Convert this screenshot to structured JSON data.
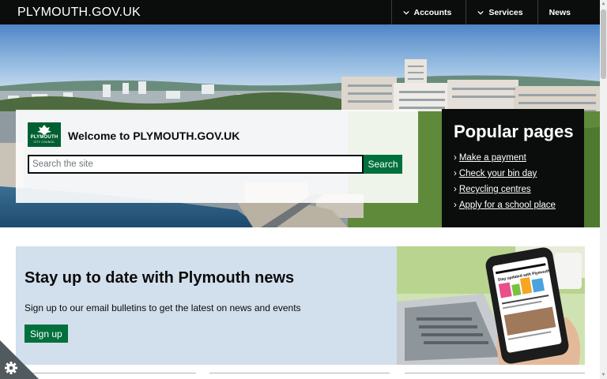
{
  "header": {
    "brand": "PLYMOUTH.GOV.UK",
    "nav": [
      {
        "label": "Accounts",
        "icon": "chevron-down-icon"
      },
      {
        "label": "Services",
        "icon": "chevron-down-icon"
      },
      {
        "label": "News"
      }
    ]
  },
  "hero": {
    "logo_text": "PLYMOUTH",
    "logo_subtext": "CITY COUNCIL",
    "welcome_title": "Welcome to PLYMOUTH.GOV.UK",
    "search": {
      "placeholder": "Search the site",
      "value": "",
      "button_label": "Search"
    }
  },
  "popular": {
    "title": "Popular pages",
    "links": [
      {
        "label": "Make a payment"
      },
      {
        "label": "Check your bin day"
      },
      {
        "label": "Recycling centres"
      },
      {
        "label": "Apply for a school place"
      }
    ]
  },
  "news": {
    "title": "Stay up to date with Plymouth news",
    "description": "Sign up to our email bulletins to get the latest on news and events",
    "button_label": "Sign up",
    "phone_headline": "Stay updated with Plymouth"
  },
  "colors": {
    "header_bg": "#0b0c0c",
    "button_green": "#00703c",
    "news_bg": "#d2dfec",
    "popular_bg": "#0b0c0c"
  },
  "cookie": {
    "icon": "gear-icon"
  }
}
